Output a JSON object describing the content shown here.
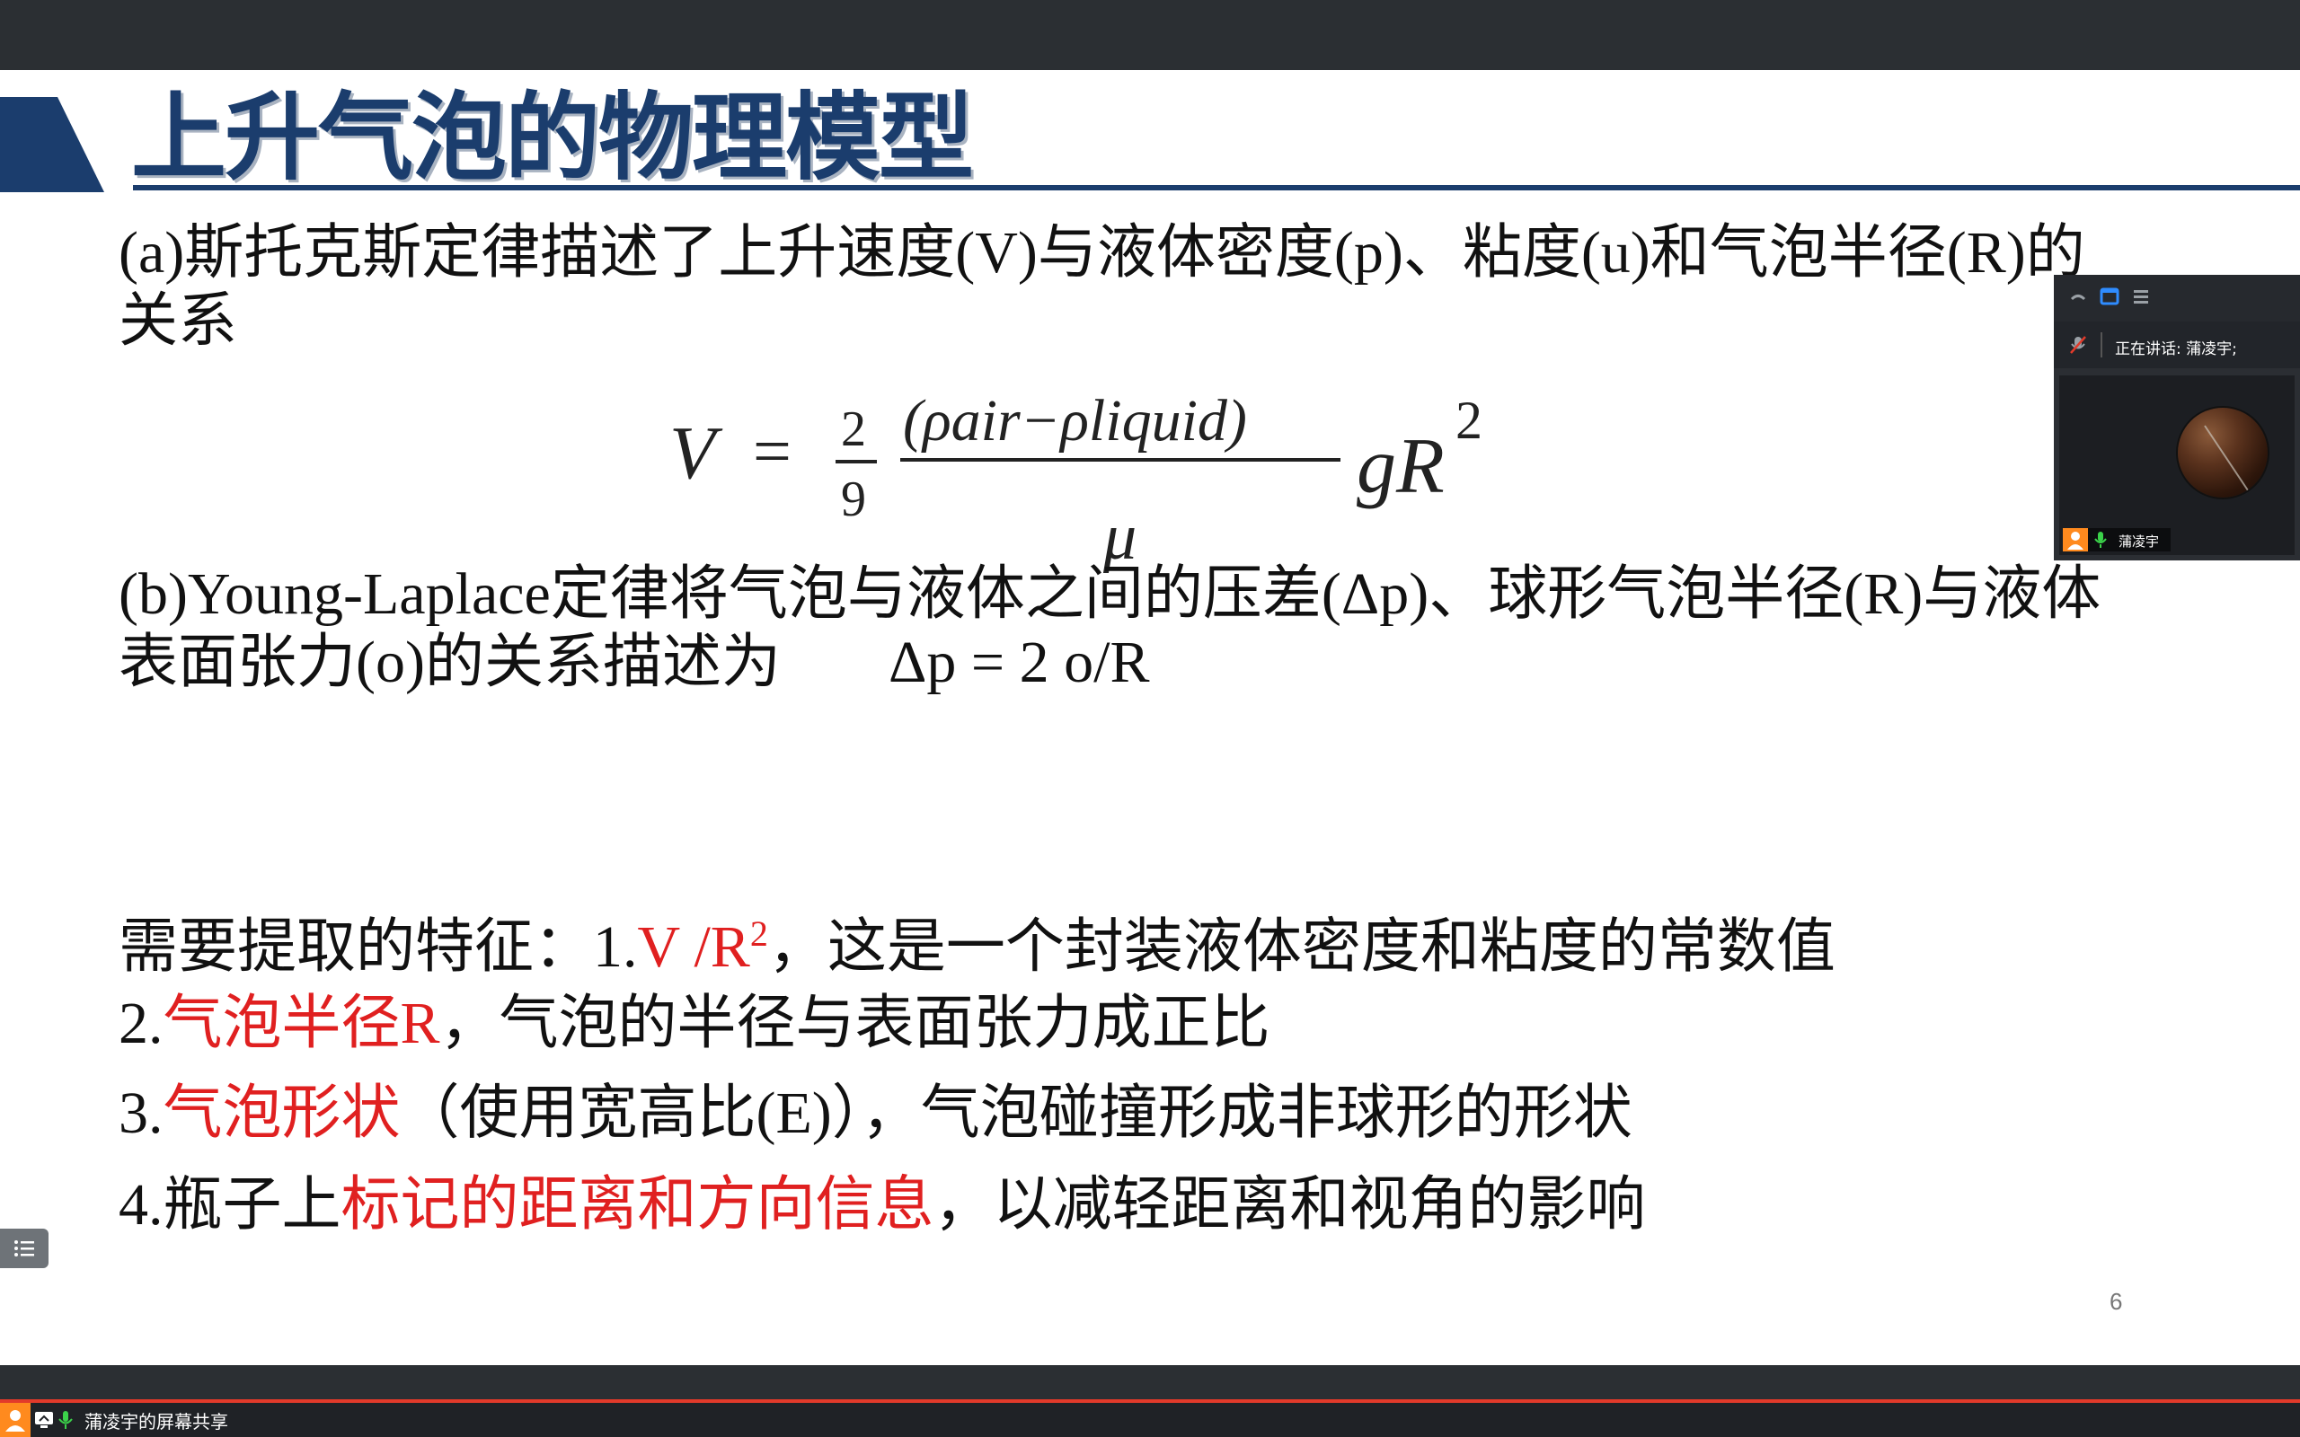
{
  "slide": {
    "title": "上升气泡的物理模型",
    "para_a": {
      "line1": "(a)斯托克斯定律描述了上升速度(V)与液体密度(p)、粘度(u)和气泡半径(R)的",
      "line2": "关系"
    },
    "formula": {
      "lhs": "V",
      "eq": "=",
      "coef_num": "2",
      "coef_den": "9",
      "frac_num": "(ρair−ρliquid)",
      "frac_den": "μ",
      "tail": "gR",
      "sup": "2"
    },
    "para_b": {
      "line1": "(b)Young-Laplace定律将气泡与液体之间的压差(Δp)、球形气泡半径(R)与液体",
      "line2": "表面张力(o)的关系描述为",
      "equation": "Δp = 2 o/R"
    },
    "features": {
      "line1_prefix": "需要提取的特征：1.",
      "line1_red": "V /R",
      "line1_sup": "2",
      "line1_suffix": "，这是一个封装液体密度和粘度的常数值",
      "line2_prefix": "2.",
      "line2_red": "气泡半径R",
      "line2_suffix": "，气泡的半径与表面张力成正比",
      "line3_prefix": "3.",
      "line3_red": "气泡形状",
      "line3_suffix": "（使用宽高比(E)），气泡碰撞形成非球形的形状",
      "line4_prefix": "4.瓶子上",
      "line4_red": "标记的距离和方向信息",
      "line4_suffix": "，以减轻距离和视角的影响"
    },
    "page_number": "6"
  },
  "video_panel": {
    "speaking_label": "正在讲话: 蒲凌宇;",
    "participant_name": "蒲凌宇"
  },
  "taskbar": {
    "share_label": "蒲凌宇的屏幕共享"
  },
  "colors": {
    "title": "#1b3d6d",
    "highlight": "#e02020",
    "bar": "#2b2f33",
    "accent_line": "#e23a2a",
    "avatar_bg": "#ff8a1e"
  },
  "icons": [
    "list-icon",
    "user-icon",
    "screen-share-icon",
    "microphone-icon",
    "mic-muted-icon",
    "minimize-icon",
    "window-icon",
    "menu-icon"
  ]
}
